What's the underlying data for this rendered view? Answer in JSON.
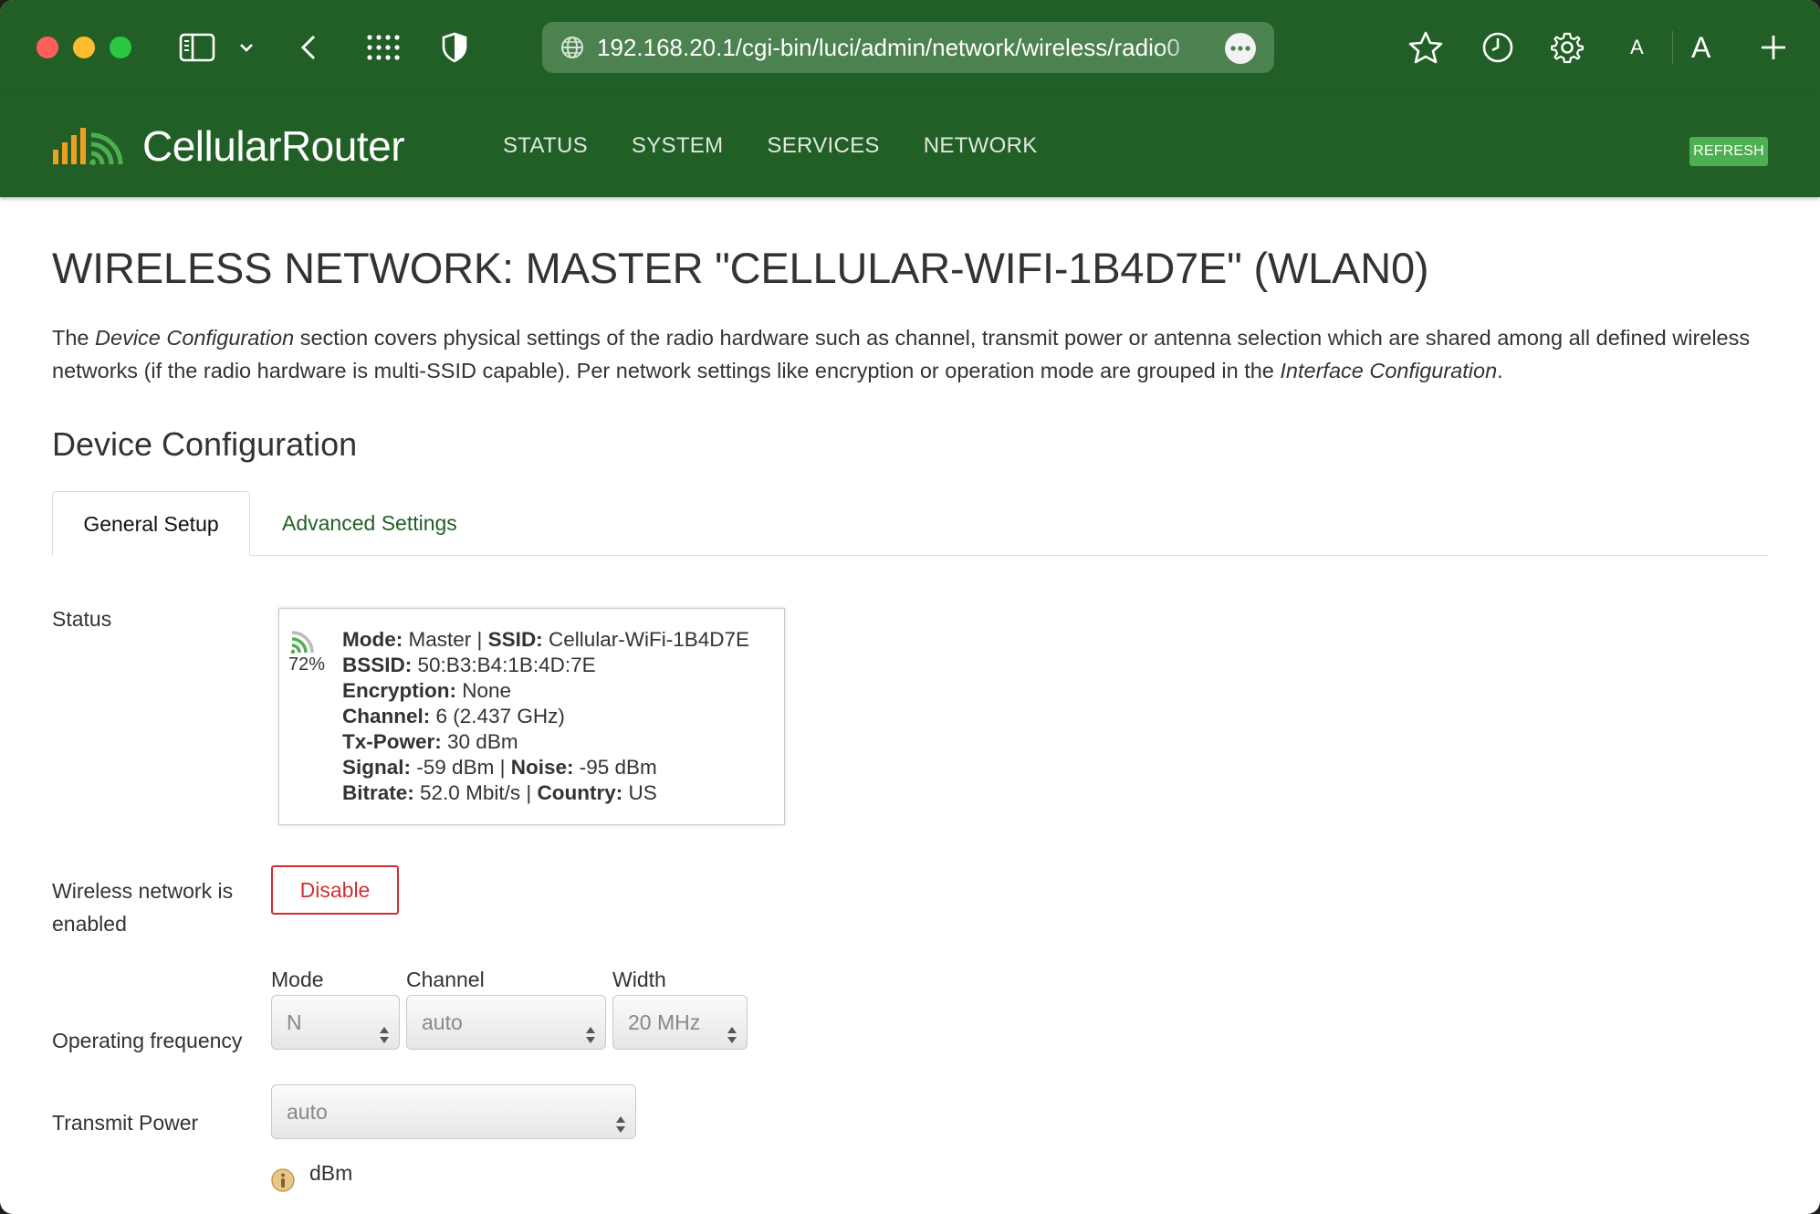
{
  "browser": {
    "url": "192.168.20.1/cgi-bin/luci/admin/network/wireless/radio0",
    "text_size_small": "A",
    "text_size_large": "A"
  },
  "header": {
    "brand": "CellularRouter",
    "nav": [
      "STATUS",
      "SYSTEM",
      "SERVICES",
      "NETWORK"
    ],
    "refresh_label": "REFRESH"
  },
  "page": {
    "title": "WIRELESS NETWORK: MASTER \"CELLULAR-WIFI-1B4D7E\" (WLAN0)",
    "intro": {
      "p1": "The ",
      "em1": "Device Configuration",
      "p2": " section covers physical settings of the radio hardware such as channel, transmit power or antenna selection which are shared among all defined wireless networks (if the radio hardware is multi-SSID capable). Per network settings like encryption or operation mode are grouped in the ",
      "em2": "Interface Configuration",
      "p3": "."
    },
    "section_title": "Device Configuration",
    "tabs": {
      "general": "General Setup",
      "advanced": "Advanced Settings"
    }
  },
  "status": {
    "label": "Status",
    "signal_percent": "72%",
    "mode_label": "Mode:",
    "mode": "Master",
    "ssid_label": "SSID:",
    "ssid": "Cellular-WiFi-1B4D7E",
    "bssid_label": "BSSID:",
    "bssid": "50:B3:B4:1B:4D:7E",
    "encryption_label": "Encryption:",
    "encryption": "None",
    "channel_label": "Channel:",
    "channel": "6 (2.437 GHz)",
    "txpower_label": "Tx-Power:",
    "txpower": "30 dBm",
    "signal_label": "Signal:",
    "signal": "-59 dBm",
    "noise_label": "Noise:",
    "noise": "-95 dBm",
    "bitrate_label": "Bitrate:",
    "bitrate": "52.0 Mbit/s",
    "country_label": "Country:",
    "country": "US",
    "separator": "|"
  },
  "enabled": {
    "label_line1": "Wireless network is",
    "label_line2": "enabled",
    "button": "Disable"
  },
  "frequency": {
    "label": "Operating frequency",
    "mode_label": "Mode",
    "mode_value": "N",
    "channel_label": "Channel",
    "channel_value": "auto",
    "width_label": "Width",
    "width_value": "20 MHz"
  },
  "txpower": {
    "label": "Transmit Power",
    "value": "auto",
    "unit": "dBm"
  },
  "colors": {
    "header_green": "#215f26",
    "refresh_green": "#4caf50",
    "disable_red": "#d32f2f",
    "logo_orange": "#f0a020"
  }
}
